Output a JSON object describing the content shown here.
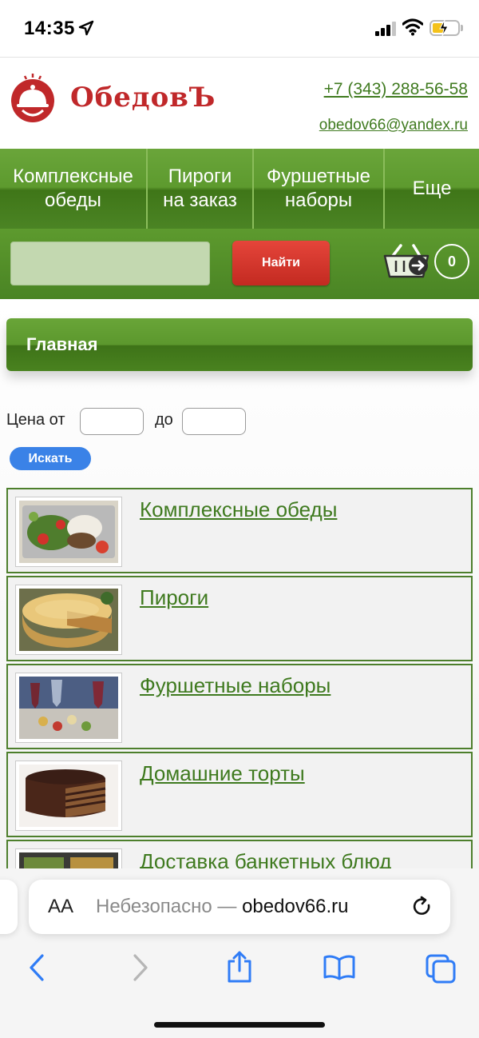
{
  "status_bar": {
    "time": "14:35",
    "icons": [
      "location-arrow-icon",
      "cellular-signal-icon",
      "wifi-icon",
      "battery-charging-icon"
    ]
  },
  "site": {
    "logo_text": "ОбедовЪ",
    "phone": "+7 (343) 288-56-58",
    "email": "obedov66@yandex.ru",
    "brand_color": "#c0282a",
    "link_color": "#3f7a1f",
    "nav_color": "#4b8424"
  },
  "nav": {
    "items": [
      {
        "label_line1": "Комплексные",
        "label_line2": "обеды"
      },
      {
        "label_line1": "Пироги",
        "label_line2": "на заказ"
      },
      {
        "label_line1": "Фуршетные",
        "label_line2": "наборы"
      },
      {
        "label_line1": "Еще",
        "label_line2": ""
      }
    ]
  },
  "search": {
    "value": "",
    "button_label": "Найти",
    "button_color": "#d1362b",
    "cart_count": "0"
  },
  "breadcrumb": {
    "label": "Главная"
  },
  "price_filter": {
    "label_from": "Цена от",
    "label_to": "до",
    "from_value": "",
    "to_value": "",
    "button_label": "Искать",
    "button_color": "#3a82e7"
  },
  "categories": [
    {
      "title": "Комплексные обеды",
      "image": "lunch-box-photo"
    },
    {
      "title": "Пироги",
      "image": "pie-photo"
    },
    {
      "title": "Фуршетные наборы",
      "image": "buffet-canapes-photo"
    },
    {
      "title": "Домашние торты",
      "image": "chocolate-cake-photo"
    },
    {
      "title": "Доставка банкетных блюд",
      "image": "banquet-trays-photo"
    }
  ],
  "browser": {
    "aa_label": "AA",
    "insecure_label": "Небезопасно —",
    "domain": "obedov66.ru",
    "toolbar_icons": [
      "back-icon",
      "forward-icon",
      "share-icon",
      "bookmarks-icon",
      "tabs-icon"
    ]
  }
}
